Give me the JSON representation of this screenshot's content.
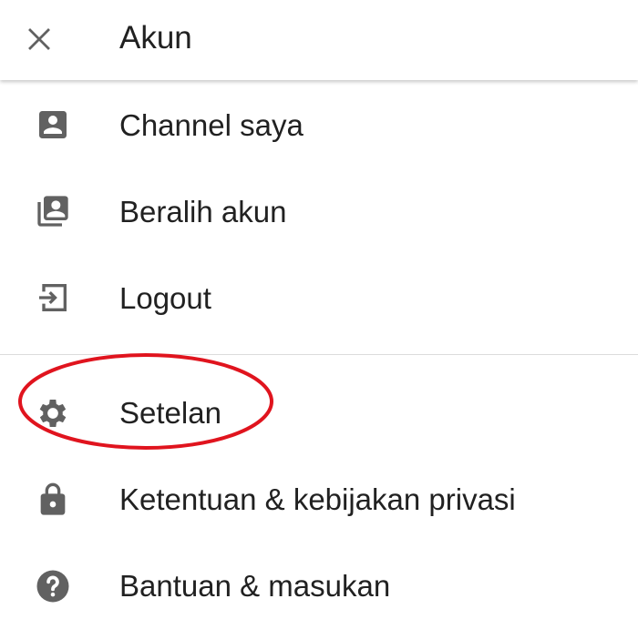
{
  "header": {
    "title": "Akun",
    "close_icon": "close-icon"
  },
  "menu": {
    "section1": [
      {
        "label": "Channel saya",
        "icon": "account-box-icon"
      },
      {
        "label": "Beralih akun",
        "icon": "switch-account-icon"
      },
      {
        "label": "Logout",
        "icon": "logout-icon"
      }
    ],
    "section2": [
      {
        "label": "Setelan",
        "icon": "gear-icon"
      },
      {
        "label": "Ketentuan & kebijakan privasi",
        "icon": "lock-icon"
      },
      {
        "label": "Bantuan & masukan",
        "icon": "help-icon"
      }
    ]
  },
  "colors": {
    "icon": "#616161",
    "text": "#212121",
    "divider": "#dcdcdc",
    "highlight": "#e0141e"
  }
}
